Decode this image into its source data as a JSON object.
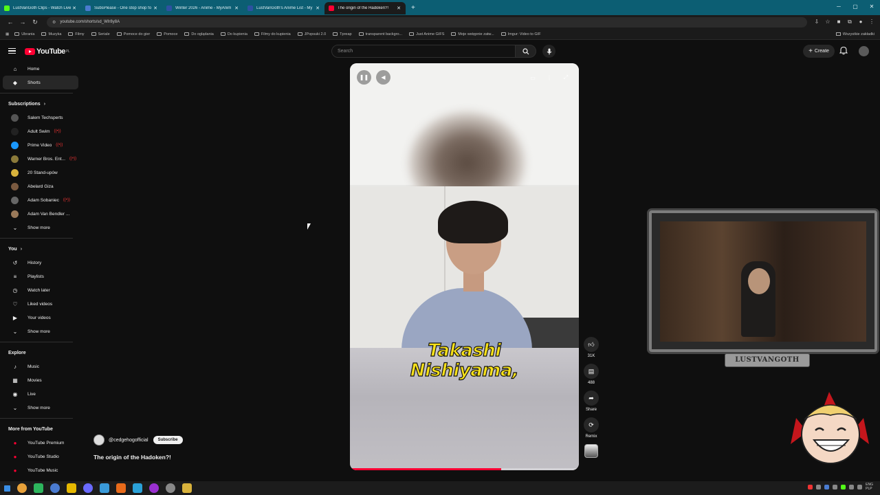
{
  "browser": {
    "tabs": [
      {
        "title": "LustVanGoth Clips - Watch Live",
        "color": "#53fc18"
      },
      {
        "title": "SubsPlease - One stop shop fo",
        "color": "#4a7bd0"
      },
      {
        "title": "Winter 2026 - Anime - MyAnim",
        "color": "#2e51a2"
      },
      {
        "title": "LustVanGoth's Anime List - My",
        "color": "#2e51a2"
      },
      {
        "title": "The origin of the Hadoken?!",
        "color": "#ff0033"
      }
    ],
    "url": "youtube.com/shorts/sd_WIr8y8A",
    "bookmarks": [
      "Ubrania",
      "Muzyka",
      "Filmy",
      "Seriale",
      "Pomoce do gier",
      "Pomoce",
      "Do oglądania",
      "Do kupienia",
      "Filmy do kupienia",
      "JPopsuki 2.0",
      "Tpreap",
      "transparent backgro...",
      "Just Anime GIFS",
      "Moje wstępnie zatw...",
      "Imgur: Video to GIF"
    ],
    "bookmarks_right": "Wszystkie zakładki"
  },
  "youtube": {
    "logo_text": "YouTube",
    "logo_region": "PL",
    "search_placeholder": "Search",
    "create_label": "Create"
  },
  "sidebar": {
    "main": [
      {
        "label": "Home",
        "icon": "home-icon"
      },
      {
        "label": "Shorts",
        "icon": "shorts-icon",
        "active": true
      }
    ],
    "subscriptions_title": "Subscriptions",
    "subscriptions": [
      {
        "label": "Salem Techsperts",
        "live": false,
        "color": "#555"
      },
      {
        "label": "Adult Swim",
        "live": true,
        "color": "#222"
      },
      {
        "label": "Prime Video",
        "live": true,
        "color": "#1a98ff"
      },
      {
        "label": "Warner Bros. Ent...",
        "live": true,
        "color": "#8b7a3a"
      },
      {
        "label": "20 Stand-upów",
        "live": false,
        "color": "#d8b23c"
      },
      {
        "label": "Abelard Giza",
        "live": false,
        "color": "#7a5a40"
      },
      {
        "label": "Adam Sobaniec",
        "live": true,
        "color": "#666"
      },
      {
        "label": "Adam Van Bendler ...",
        "live": false,
        "color": "#9a7a5a"
      }
    ],
    "show_more": "Show more",
    "you_title": "You",
    "you": [
      {
        "label": "History",
        "icon": "history-icon"
      },
      {
        "label": "Playlists",
        "icon": "playlists-icon"
      },
      {
        "label": "Watch later",
        "icon": "watch-later-icon"
      },
      {
        "label": "Liked videos",
        "icon": "liked-videos-icon"
      },
      {
        "label": "Your videos",
        "icon": "your-videos-icon"
      }
    ],
    "explore_title": "Explore",
    "explore": [
      {
        "label": "Music",
        "icon": "music-icon"
      },
      {
        "label": "Movies",
        "icon": "movies-icon"
      },
      {
        "label": "Live",
        "icon": "live-icon"
      }
    ],
    "more_title": "More from YouTube",
    "more": [
      {
        "label": "YouTube Premium"
      },
      {
        "label": "YouTube Studio"
      },
      {
        "label": "YouTube Music"
      }
    ]
  },
  "short": {
    "caption_line1": "Takashi",
    "caption_line2": "Nishiyama,",
    "progress": 0.66,
    "channel": "@cedgehogofficial",
    "subscribe_label": "Subscribe",
    "title": "The origin of the Hadoken?!"
  },
  "actions": {
    "likes": "31K",
    "comments": "488",
    "share": "Share",
    "remix": "Remix"
  },
  "overlay": {
    "nameplate": "LUSTVANGOTH"
  },
  "taskbar": {
    "lang_top": "ENG",
    "lang_bottom": "PLP"
  }
}
